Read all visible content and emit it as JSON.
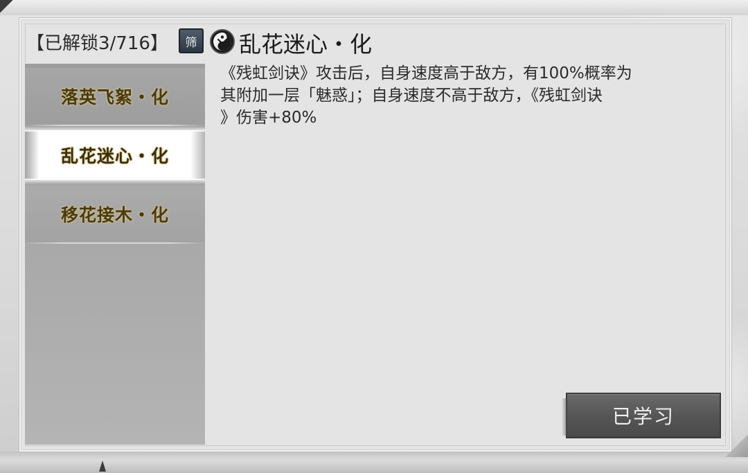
{
  "header": {
    "unlocked_label": "【已解锁3/716】",
    "filter_label": "筛",
    "skill_icon": "yin-yang-figure-icon",
    "skill_title": "乱花迷心・化"
  },
  "sidebar": {
    "items": [
      {
        "label": "落英飞絮・化",
        "active": false
      },
      {
        "label": "乱花迷心・化",
        "active": true
      },
      {
        "label": "移花接木・化",
        "active": false
      }
    ]
  },
  "description": {
    "line1": "《残虹剑诀》攻击后，自身速度高于敌方，有100%概率为",
    "line2": "其附加一层「魅惑」；自身速度不高于敌方，《残虹剑诀",
    "line3": "》伤害+80%"
  },
  "actions": {
    "learned_label": "已学习"
  },
  "colors": {
    "sidebar_text": "#4a3a12",
    "button_bg": "#565656",
    "panel_bg": "#e4e4e4"
  }
}
